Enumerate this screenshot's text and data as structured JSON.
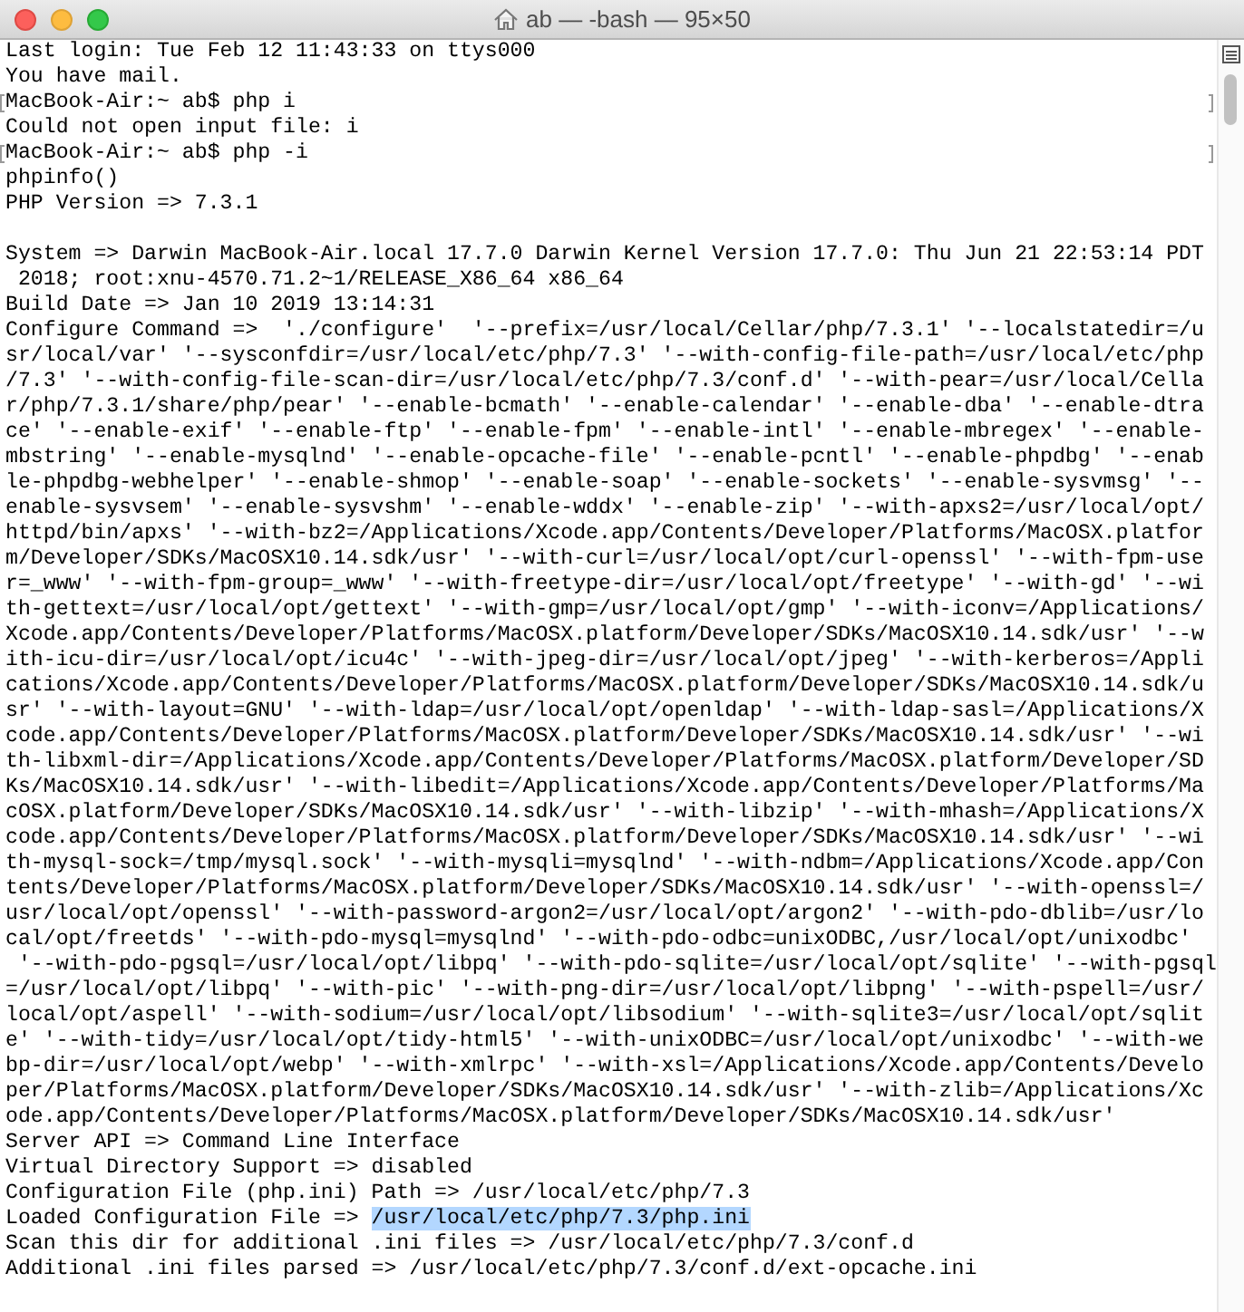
{
  "window": {
    "title": "ab — -bash — 95×50"
  },
  "terminal": {
    "blocks": [
      {
        "lines": [
          {
            "kind": "output",
            "text": "Last login: Tue Feb 12 11:43:33 on ttys000"
          },
          {
            "kind": "output",
            "text": "You have mail."
          },
          {
            "kind": "prompt",
            "text": "MacBook-Air:~ ab$ php i"
          },
          {
            "kind": "output",
            "text": "Could not open input file: i"
          },
          {
            "kind": "prompt",
            "text": "MacBook-Air:~ ab$ php -i"
          },
          {
            "kind": "output",
            "text": "phpinfo()"
          },
          {
            "kind": "output",
            "text": "PHP Version => 7.3.1"
          }
        ]
      },
      {
        "lines": [
          {
            "kind": "output",
            "text": "System => Darwin MacBook-Air.local 17.7.0 Darwin Kernel Version 17.7.0: Thu Jun 21 22:53:14 PDT"
          },
          {
            "kind": "output",
            "text": " 2018; root:xnu-4570.71.2~1/RELEASE_X86_64 x86_64"
          },
          {
            "kind": "output",
            "text": "Build Date => Jan 10 2019 13:14:31"
          },
          {
            "kind": "output",
            "text": "Configure Command =>  './configure'  '--prefix=/usr/local/Cellar/php/7.3.1' '--localstatedir=/u"
          },
          {
            "kind": "output",
            "text": "sr/local/var' '--sysconfdir=/usr/local/etc/php/7.3' '--with-config-file-path=/usr/local/etc/php"
          },
          {
            "kind": "output",
            "text": "/7.3' '--with-config-file-scan-dir=/usr/local/etc/php/7.3/conf.d' '--with-pear=/usr/local/Cella"
          },
          {
            "kind": "output",
            "text": "r/php/7.3.1/share/php/pear' '--enable-bcmath' '--enable-calendar' '--enable-dba' '--enable-dtra"
          },
          {
            "kind": "output",
            "text": "ce' '--enable-exif' '--enable-ftp' '--enable-fpm' '--enable-intl' '--enable-mbregex' '--enable-"
          },
          {
            "kind": "output",
            "text": "mbstring' '--enable-mysqlnd' '--enable-opcache-file' '--enable-pcntl' '--enable-phpdbg' '--enab"
          },
          {
            "kind": "output",
            "text": "le-phpdbg-webhelper' '--enable-shmop' '--enable-soap' '--enable-sockets' '--enable-sysvmsg' '--"
          },
          {
            "kind": "output",
            "text": "enable-sysvsem' '--enable-sysvshm' '--enable-wddx' '--enable-zip' '--with-apxs2=/usr/local/opt/"
          },
          {
            "kind": "output",
            "text": "httpd/bin/apxs' '--with-bz2=/Applications/Xcode.app/Contents/Developer/Platforms/MacOSX.platfor"
          },
          {
            "kind": "output",
            "text": "m/Developer/SDKs/MacOSX10.14.sdk/usr' '--with-curl=/usr/local/opt/curl-openssl' '--with-fpm-use"
          },
          {
            "kind": "output",
            "text": "r=_www' '--with-fpm-group=_www' '--with-freetype-dir=/usr/local/opt/freetype' '--with-gd' '--wi"
          },
          {
            "kind": "output",
            "text": "th-gettext=/usr/local/opt/gettext' '--with-gmp=/usr/local/opt/gmp' '--with-iconv=/Applications/"
          },
          {
            "kind": "output",
            "text": "Xcode.app/Contents/Developer/Platforms/MacOSX.platform/Developer/SDKs/MacOSX10.14.sdk/usr' '--w"
          },
          {
            "kind": "output",
            "text": "ith-icu-dir=/usr/local/opt/icu4c' '--with-jpeg-dir=/usr/local/opt/jpeg' '--with-kerberos=/Appli"
          },
          {
            "kind": "output",
            "text": "cations/Xcode.app/Contents/Developer/Platforms/MacOSX.platform/Developer/SDKs/MacOSX10.14.sdk/u"
          },
          {
            "kind": "output",
            "text": "sr' '--with-layout=GNU' '--with-ldap=/usr/local/opt/openldap' '--with-ldap-sasl=/Applications/X"
          },
          {
            "kind": "output",
            "text": "code.app/Contents/Developer/Platforms/MacOSX.platform/Developer/SDKs/MacOSX10.14.sdk/usr' '--wi"
          },
          {
            "kind": "output",
            "text": "th-libxml-dir=/Applications/Xcode.app/Contents/Developer/Platforms/MacOSX.platform/Developer/SD"
          },
          {
            "kind": "output",
            "text": "Ks/MacOSX10.14.sdk/usr' '--with-libedit=/Applications/Xcode.app/Contents/Developer/Platforms/Ma"
          },
          {
            "kind": "output",
            "text": "cOSX.platform/Developer/SDKs/MacOSX10.14.sdk/usr' '--with-libzip' '--with-mhash=/Applications/X"
          },
          {
            "kind": "output",
            "text": "code.app/Contents/Developer/Platforms/MacOSX.platform/Developer/SDKs/MacOSX10.14.sdk/usr' '--wi"
          },
          {
            "kind": "output",
            "text": "th-mysql-sock=/tmp/mysql.sock' '--with-mysqli=mysqlnd' '--with-ndbm=/Applications/Xcode.app/Con"
          },
          {
            "kind": "output",
            "text": "tents/Developer/Platforms/MacOSX.platform/Developer/SDKs/MacOSX10.14.sdk/usr' '--with-openssl=/"
          },
          {
            "kind": "output",
            "text": "usr/local/opt/openssl' '--with-password-argon2=/usr/local/opt/argon2' '--with-pdo-dblib=/usr/lo"
          },
          {
            "kind": "output",
            "text": "cal/opt/freetds' '--with-pdo-mysql=mysqlnd' '--with-pdo-odbc=unixODBC,/usr/local/opt/unixodbc'"
          },
          {
            "kind": "output",
            "text": " '--with-pdo-pgsql=/usr/local/opt/libpq' '--with-pdo-sqlite=/usr/local/opt/sqlite' '--with-pgsql"
          },
          {
            "kind": "output",
            "text": "=/usr/local/opt/libpq' '--with-pic' '--with-png-dir=/usr/local/opt/libpng' '--with-pspell=/usr/"
          },
          {
            "kind": "output",
            "text": "local/opt/aspell' '--with-sodium=/usr/local/opt/libsodium' '--with-sqlite3=/usr/local/opt/sqlit"
          },
          {
            "kind": "output",
            "text": "e' '--with-tidy=/usr/local/opt/tidy-html5' '--with-unixODBC=/usr/local/opt/unixodbc' '--with-we"
          },
          {
            "kind": "output",
            "text": "bp-dir=/usr/local/opt/webp' '--with-xmlrpc' '--with-xsl=/Applications/Xcode.app/Contents/Develo"
          },
          {
            "kind": "output",
            "text": "per/Platforms/MacOSX.platform/Developer/SDKs/MacOSX10.14.sdk/usr' '--with-zlib=/Applications/Xc"
          },
          {
            "kind": "output",
            "text": "ode.app/Contents/Developer/Platforms/MacOSX.platform/Developer/SDKs/MacOSX10.14.sdk/usr'"
          },
          {
            "kind": "output",
            "text": "Server API => Command Line Interface"
          },
          {
            "kind": "output",
            "text": "Virtual Directory Support => disabled"
          },
          {
            "kind": "output",
            "text": "Configuration File (php.ini) Path => /usr/local/etc/php/7.3"
          },
          {
            "kind": "output",
            "text": "Loaded Configuration File => ",
            "selected_text": "/usr/local/etc/php/7.3/php.ini"
          },
          {
            "kind": "output",
            "text": "Scan this dir for additional .ini files => /usr/local/etc/php/7.3/conf.d"
          },
          {
            "kind": "output",
            "text": "Additional .ini files parsed => /usr/local/etc/php/7.3/conf.d/ext-opcache.ini"
          }
        ]
      }
    ]
  }
}
